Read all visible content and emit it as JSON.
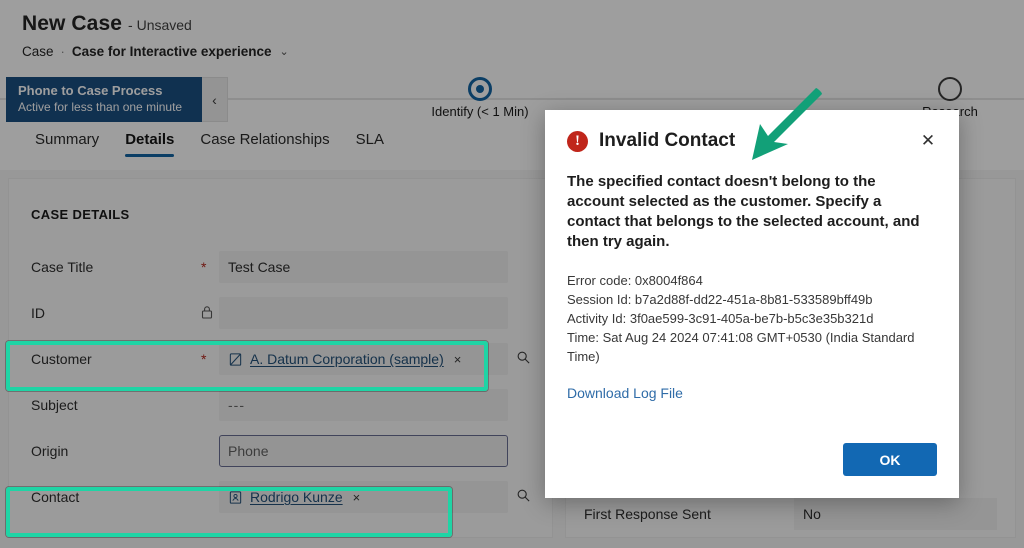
{
  "header": {
    "title": "New Case",
    "save_state": "- Unsaved",
    "breadcrumb_entity": "Case",
    "breadcrumb_separator": "·",
    "breadcrumb_form": "Case for Interactive experience",
    "form_chevron": "⌄"
  },
  "process_flow": {
    "name": "Phone to Case Process",
    "status": "Active for less than one minute",
    "collapse_icon": "‹",
    "stages": [
      {
        "label": "Identify  (< 1 Min)",
        "state": "active"
      },
      {
        "label": "Research",
        "state": "idle"
      }
    ]
  },
  "tabs": [
    {
      "label": "Summary",
      "active": false
    },
    {
      "label": "Details",
      "active": true
    },
    {
      "label": "Case Relationships",
      "active": false
    },
    {
      "label": "SLA",
      "active": false
    }
  ],
  "form": {
    "section_title": "CASE DETAILS",
    "required_marker": "*",
    "lock_icon": "🔒",
    "search_icon": "search-icon",
    "fields": [
      {
        "label": "Case Title",
        "required": true,
        "value": "Test Case",
        "type": "text"
      },
      {
        "label": "ID",
        "required": false,
        "locked": true,
        "value": "",
        "type": "text"
      },
      {
        "label": "Customer",
        "required": true,
        "type": "lookup",
        "value": "A. Datum Corporation (sample)",
        "clear": "×"
      },
      {
        "label": "Subject",
        "required": false,
        "type": "text",
        "value": "---"
      },
      {
        "label": "Origin",
        "required": false,
        "type": "select",
        "value": "Phone"
      },
      {
        "label": "Contact",
        "required": false,
        "type": "lookup",
        "value": "Rodrigo Kunze",
        "clear": "×"
      }
    ],
    "right_fields": [
      {
        "label": "First Response Sent",
        "value": "No"
      }
    ]
  },
  "dialog": {
    "icon": "error-icon",
    "icon_glyph": "!",
    "title": "Invalid Contact",
    "close_glyph": "✕",
    "message": "The specified contact doesn't belong to the account selected as the customer. Specify a contact that belongs to the selected account, and then try again.",
    "error_code": "Error code: 0x8004f864",
    "session_id": "Session Id: b7a2d88f-dd22-451a-8b81-533589bff49b",
    "activity_id": "Activity Id: 3f0ae599-3c91-405a-be7b-b5c3e35b321d",
    "time": "Time: Sat Aug 24 2024 07:41:08 GMT+0530 (India Standard Time)",
    "download_link": "Download Log File",
    "ok_label": "OK"
  },
  "colors": {
    "process_blue": "#1b4f82",
    "accent_blue": "#1264a3",
    "primary_button": "#1268b3",
    "error_red": "#c0261b",
    "annotation_teal": "#1fd4a5",
    "link_blue": "#2f6ca8",
    "lookup_link": "#24527a"
  }
}
